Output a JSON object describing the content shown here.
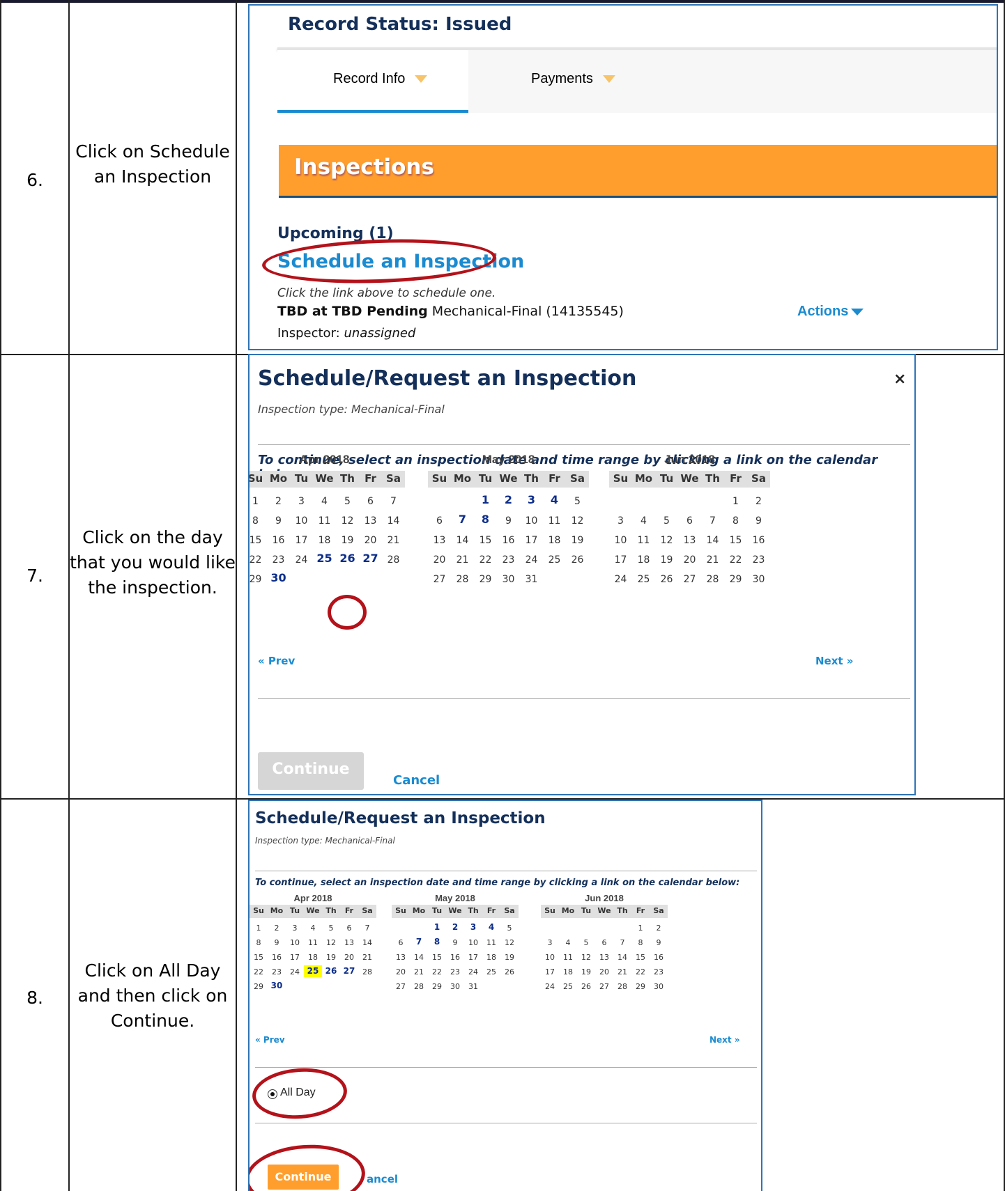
{
  "steps": [
    {
      "number": "6.",
      "description": "Click on Schedule an Inspection"
    },
    {
      "number": "7.",
      "description": "Click on the day that you would like the inspection."
    },
    {
      "number": "8.",
      "description": "Click on All Day and then click on Continue."
    }
  ],
  "step6": {
    "record_status": "Record Status: Issued",
    "tabs": [
      "Record Info",
      "Payments"
    ],
    "section_title": "Inspections",
    "upcoming": "Upcoming (1)",
    "schedule_link": "Schedule an Inspection",
    "hint": "Click the link above to schedule one.",
    "tbd_bold": "TBD at TBD Pending",
    "tbd_rest": " Mechanical-Final (14135545)",
    "inspector_label": "Inspector: ",
    "inspector_value": "unassigned",
    "actions": "Actions"
  },
  "dialog": {
    "title": "Schedule/Request an Inspection",
    "close": "×",
    "inspection_type": "Inspection type: Mechanical-Final",
    "instruction": "To continue, select an inspection date and time range by clicking a link on the calendar below:",
    "prev": "« Prev",
    "next": "Next »",
    "continue": "Continue",
    "cancel": "Cancel",
    "cancel_partial": "ancel",
    "all_day": "All Day"
  },
  "weekday_headers": [
    "Su",
    "Mo",
    "Tu",
    "We",
    "Th",
    "Fr",
    "Sa"
  ],
  "months": [
    {
      "title": "Apr 2018",
      "first_weekday": 0,
      "days": 30,
      "active": [
        25,
        26,
        27,
        30
      ]
    },
    {
      "title": "May 2018",
      "first_weekday": 2,
      "days": 31,
      "active": [
        1,
        2,
        3,
        4,
        7,
        8
      ]
    },
    {
      "title": "Jun 2018",
      "first_weekday": 5,
      "days": 30,
      "active": []
    }
  ],
  "selected_date": "Apr 2018 25"
}
